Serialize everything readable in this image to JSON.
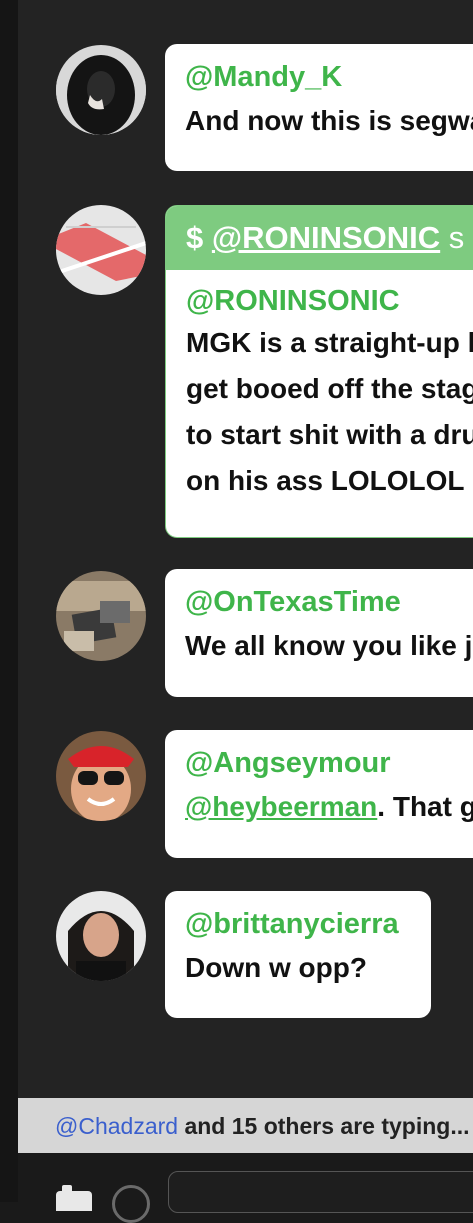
{
  "messages": [
    {
      "author": "@Mandy_K",
      "lines": [
        "And now this is segway"
      ]
    },
    {
      "author": "@OnTexasTime",
      "lines": [
        "We all know you like jo"
      ]
    },
    {
      "author": "@Angseymour",
      "mention": "@heybeerman",
      "after_mention": ". That g"
    },
    {
      "author": "@brittanycierra",
      "lines": [
        "Down w opp?"
      ]
    }
  ],
  "superchat": {
    "symbol": "$",
    "handle": "@RONINSONIC",
    "handle_suffix": "s",
    "author": "@RONINSONIC",
    "lines": [
      "MGK is a straight-up l",
      "get booed off the stage",
      "to start shit with a drun",
      "on his ass LOLOLOL"
    ]
  },
  "typing": {
    "names": "@Chadzard",
    "rest": " and 15 others are typing..."
  },
  "composer": {
    "camera_icon": "camera-icon",
    "emoji_icon": "emoji-icon"
  },
  "colors": {
    "accent": "#3fb54a",
    "superchat_header": "#7ecb80",
    "typing_link": "#3a5fcd"
  }
}
